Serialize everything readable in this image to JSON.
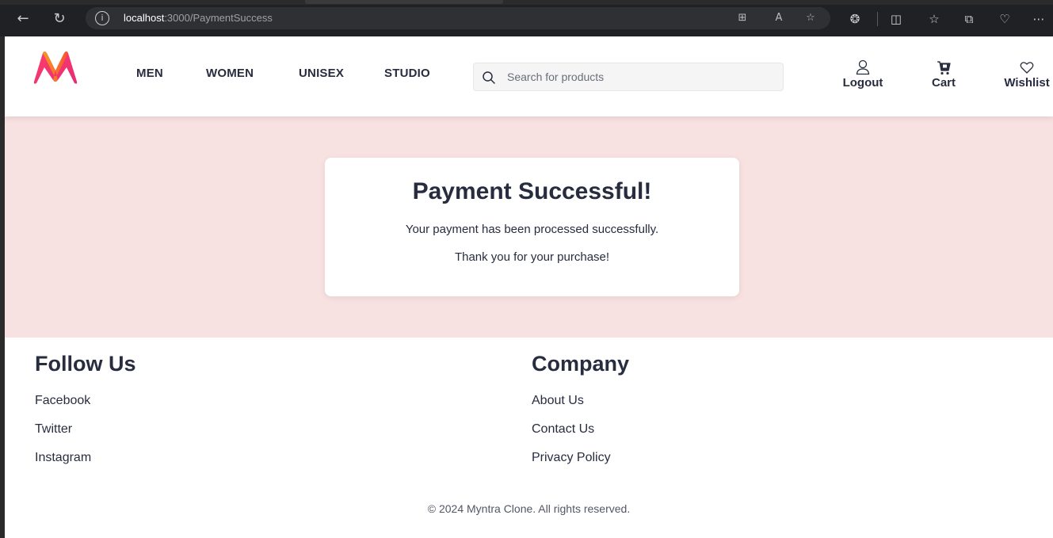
{
  "browser": {
    "url_host": "localhost",
    "url_path": ":3000/PaymentSuccess",
    "icons": [
      "back-icon",
      "refresh-icon",
      "info-icon",
      "grid-icon",
      "read-aloud-icon",
      "favorite-star-icon",
      "extensions-icon",
      "split-screen-icon",
      "favorites-icon",
      "collections-icon",
      "performance-icon",
      "more-icon"
    ]
  },
  "header": {
    "nav": [
      "MEN",
      "WOMEN",
      "UNISEX",
      "STUDIO"
    ],
    "search_placeholder": "Search for products",
    "actions": {
      "logout": "Logout",
      "cart": "Cart",
      "wishlist": "Wishlist"
    }
  },
  "main": {
    "title": "Payment Successful!",
    "message1": "Your payment has been processed successfully.",
    "message2": "Thank you for your purchase!"
  },
  "footer": {
    "follow": {
      "title": "Follow Us",
      "links": [
        "Facebook",
        "Twitter",
        "Instagram"
      ]
    },
    "company": {
      "title": "Company",
      "links": [
        "About Us",
        "Contact Us",
        "Privacy Policy"
      ]
    },
    "copyright": "© 2024 Myntra Clone. All rights reserved."
  },
  "colors": {
    "main_bg": "#f8e1e1",
    "text": "#282c3f",
    "logo_pink": "#ff3f6c",
    "logo_orange": "#f7a21b"
  }
}
